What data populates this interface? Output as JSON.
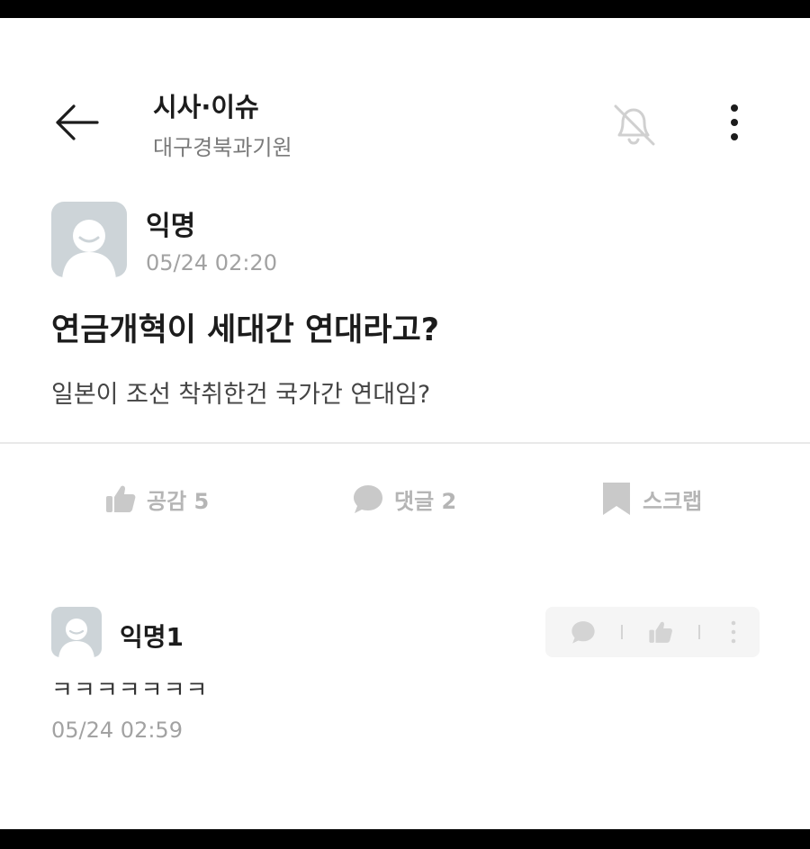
{
  "header": {
    "title": "시사·이슈",
    "subtitle": "대구경북과기원",
    "icons": [
      "arrow-left-icon",
      "bell-off-icon",
      "more-vertical-icon"
    ]
  },
  "post": {
    "author": "익명",
    "time": "05/24 02:20",
    "title": "연금개혁이 세대간 연대라고?",
    "body": "일본이 조선 착취한건 국가간 연대임?"
  },
  "actions": {
    "like_label": "공감 5",
    "comment_label": "댓글 2",
    "scrap_label": "스크랩"
  },
  "comments": [
    {
      "author": "익명1",
      "text": "ㅋㅋㅋㅋㅋㅋㅋ",
      "time": "05/24 02:59"
    }
  ],
  "colors": {
    "text_primary": "#1c1c1c",
    "text_muted": "#a2a2a2",
    "icon_muted": "#c9c9c9",
    "avatar_bg": "#cdd4d8",
    "divider": "#e9e9e9"
  }
}
